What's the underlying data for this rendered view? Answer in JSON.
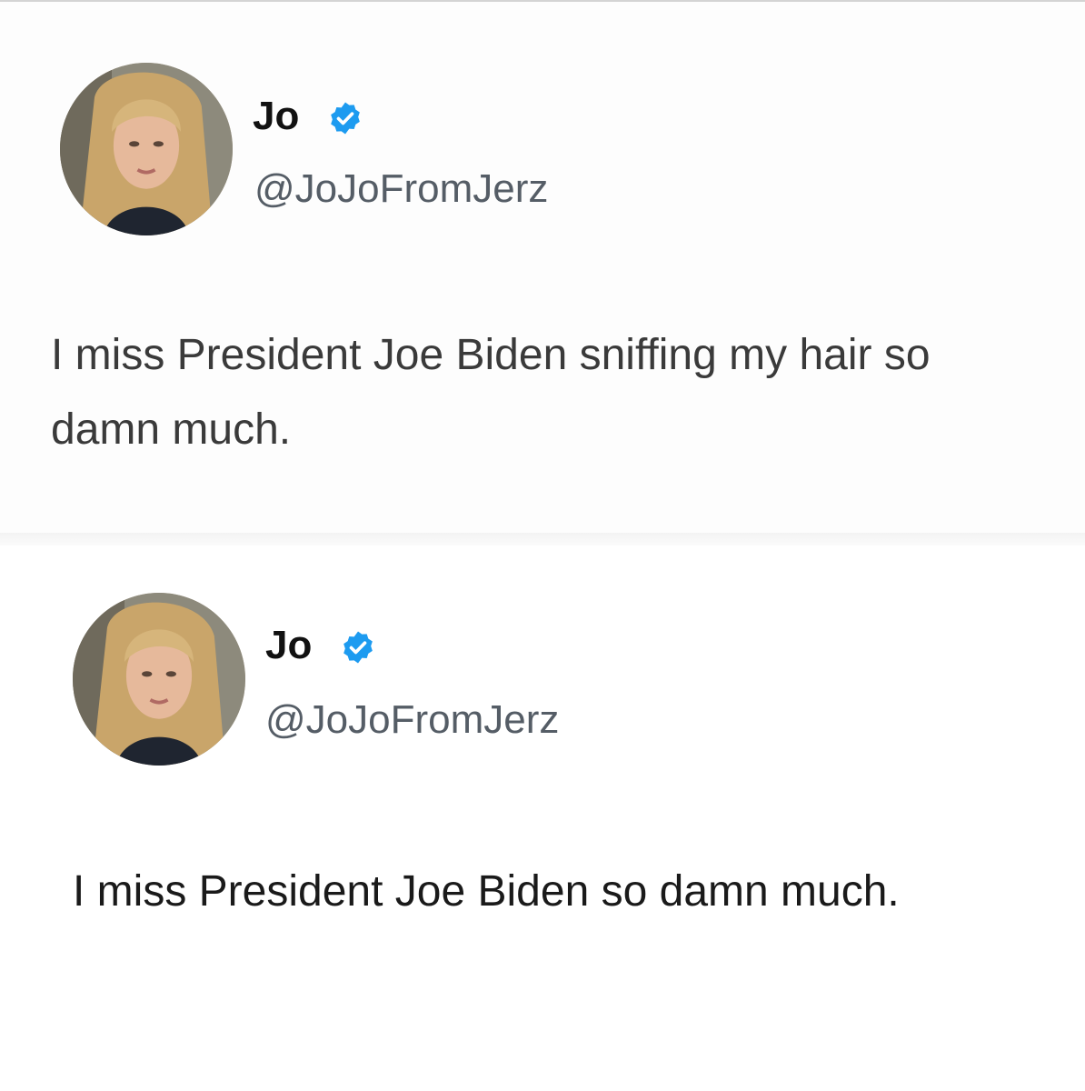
{
  "tweets": [
    {
      "author": {
        "display_name": "Jo",
        "handle": "@JoJoFromJerz",
        "verified_icon": "verified-badge-icon",
        "verified_color": "#1d9bf0"
      },
      "text": "I miss President Joe Biden sniffing my hair so damn much."
    },
    {
      "author": {
        "display_name": "Jo",
        "handle": "@JoJoFromJerz",
        "verified_icon": "verified-badge-icon",
        "verified_color": "#1d9bf0"
      },
      "text": "I miss President Joe Biden so damn much."
    }
  ],
  "colors": {
    "background": "#ffffff",
    "name_color": "#111111",
    "handle_color": "#555d66",
    "text_color": "#1a1a1a"
  }
}
